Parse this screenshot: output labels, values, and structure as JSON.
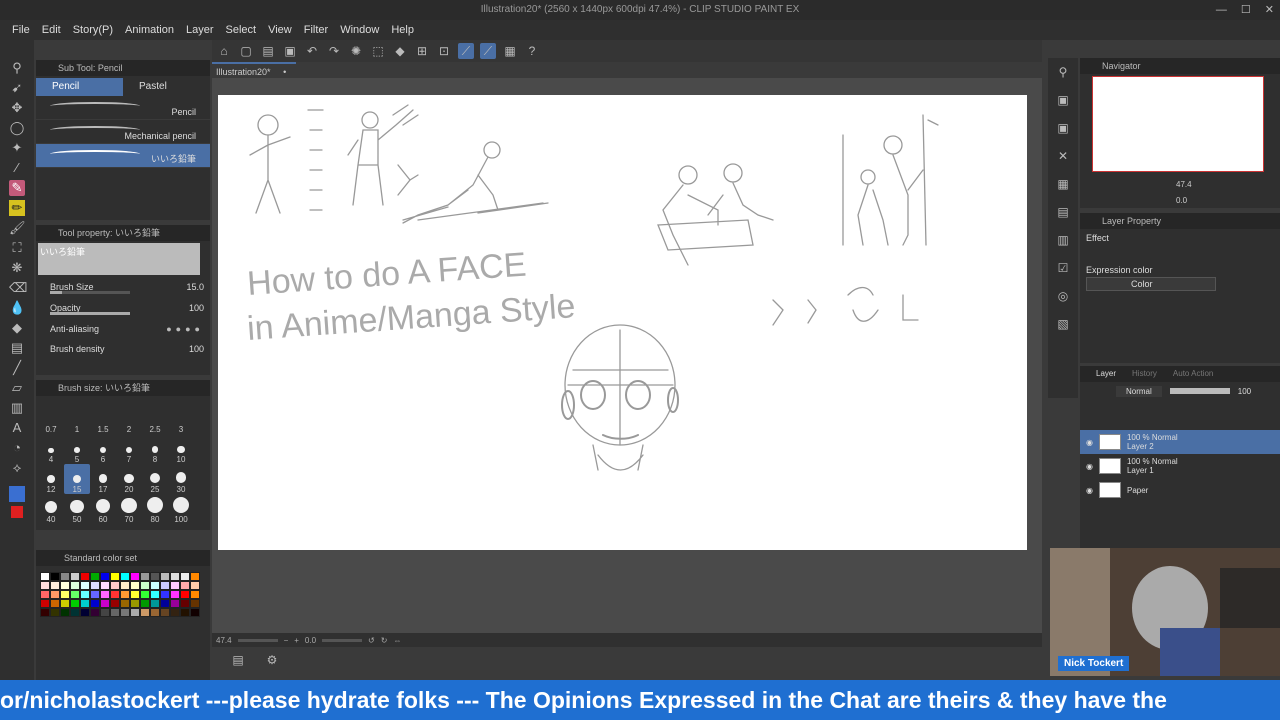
{
  "window": {
    "title": "Illustration20* (2560 x 1440px 600dpi 47.4%) - CLIP STUDIO PAINT EX"
  },
  "menu": [
    "File",
    "Edit",
    "Story(P)",
    "Animation",
    "Layer",
    "Select",
    "View",
    "Filter",
    "Window",
    "Help"
  ],
  "document_tab": "Illustration20*",
  "subtool": {
    "title": "Sub Tool: Pencil",
    "tabs": [
      "Pencil",
      "Pastel"
    ],
    "brushes": [
      "Pencil",
      "Mechanical pencil",
      "いいろ鉛筆"
    ]
  },
  "tool_property": {
    "title": "Tool property: いいろ鉛筆",
    "preview_label": "いいろ鉛筆",
    "brush_size_label": "Brush Size",
    "brush_size_value": "15.0",
    "brush_size_fraction": 0.15,
    "opacity_label": "Opacity",
    "opacity_value": "100",
    "opacity_fraction": 1.0,
    "anti_aliasing_label": "Anti-aliasing",
    "brush_density_label": "Brush density",
    "brush_density_value": "100"
  },
  "brush_size_panel": {
    "title": "Brush size: いいろ鉛筆",
    "sizes": [
      "0.7",
      "1",
      "1.5",
      "2",
      "2.5",
      "3",
      "4",
      "5",
      "6",
      "7",
      "8",
      "10",
      "12",
      "15",
      "17",
      "20",
      "25",
      "30",
      "40",
      "50",
      "60",
      "70",
      "80",
      "100"
    ],
    "selected": "15"
  },
  "color_set": {
    "title": "Standard color set"
  },
  "canvas": {
    "zoom": "47.4",
    "rotation": "0.0",
    "heading_line1": "How to do A FACE",
    "heading_line2": "in Anime/Manga Style"
  },
  "navigator": {
    "title": "Navigator",
    "zoom": "47.4",
    "angle": "0.0"
  },
  "layer_property": {
    "title": "Layer Property",
    "effect_label": "Effect",
    "expression_color_label": "Expression color",
    "expression_color_value": "Color"
  },
  "layer_panel": {
    "tabs": [
      "Layer",
      "History",
      "Auto Action"
    ],
    "blend_mode": "Normal",
    "opacity": "100",
    "layers": [
      {
        "mode": "100 % Normal",
        "name": "Layer 2"
      },
      {
        "mode": "100 % Normal",
        "name": "Layer 1"
      },
      {
        "mode": "",
        "name": "Paper"
      }
    ]
  },
  "webcam": {
    "name": "Nick Tockert"
  },
  "ticker": {
    "text": "or/nicholastockert ---please hydrate folks --- The Opinions Expressed in the Chat are theirs & they have the"
  },
  "colors": {
    "accent": "#4a6fa5",
    "ticker_bg": "#1f6fd1",
    "pen_tool": "#c35a7a"
  }
}
